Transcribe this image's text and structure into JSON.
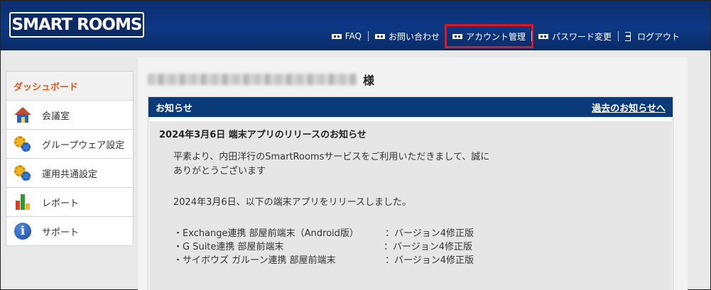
{
  "header": {
    "logo_text": "SMART ROOMS",
    "nav": [
      {
        "label": "FAQ",
        "icon": "card-icon"
      },
      {
        "label": "お問い合わせ",
        "icon": "card-icon"
      },
      {
        "label": "アカウント管理",
        "icon": "card-icon",
        "highlighted": true
      },
      {
        "label": "パスワード変更",
        "icon": "card-icon"
      },
      {
        "label": "ログアウト",
        "icon": "logout-icon"
      }
    ]
  },
  "sidebar": {
    "items": [
      {
        "label": "ダッシュボード",
        "active": true
      },
      {
        "label": "会議室",
        "icon": "house-icon"
      },
      {
        "label": "グループウェア設定",
        "icon": "gears-icon"
      },
      {
        "label": "運用共通設定",
        "icon": "gears-icon"
      },
      {
        "label": "レポート",
        "icon": "bar-chart-icon"
      },
      {
        "label": "サポート",
        "icon": "info-icon"
      }
    ]
  },
  "main": {
    "honorific": "様",
    "notice": {
      "title": "お知らせ",
      "past_link": "過去のお知らせへ",
      "article_title": "2024年3月6日 端末アプリのリリースのお知らせ",
      "para1_line1": "平素より、内田洋行のSmartRoomsサービスをご利用いただきまして、誠に",
      "para1_line2": "ありがとうございます",
      "para2": "2024年3月6日、以下の端末アプリをリリースしました。",
      "list": [
        {
          "item": "・Exchange連携 部屋前端末（Android版）",
          "version": "：バージョン4修正版"
        },
        {
          "item": "・G Suite連携 部屋前端末",
          "version": "：バージョン4修正版"
        },
        {
          "item": "・サイボウズ ガルーン連携 部屋前端末",
          "version": "：バージョン4修正版"
        }
      ]
    }
  },
  "colors": {
    "header_bg": "#0d3884",
    "accent_active": "#e5591e",
    "highlight_box": "#e3141b",
    "notice_header": "#0b3a78"
  }
}
